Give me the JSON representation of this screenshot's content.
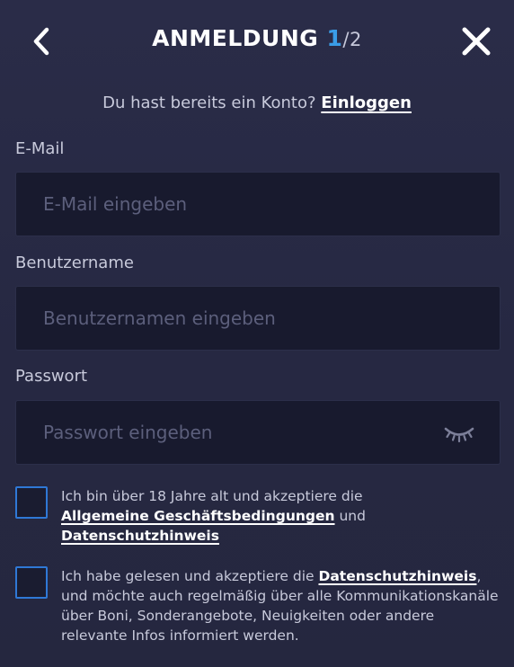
{
  "header": {
    "title": "ANMELDUNG",
    "step_current": "1",
    "step_total": "/2",
    "back_icon": "chevron-left-icon",
    "close_icon": "close-icon"
  },
  "login_prompt": {
    "text": "Du hast bereits ein Konto?",
    "link": "Einloggen"
  },
  "fields": {
    "email": {
      "label": "E-Mail",
      "value": "",
      "placeholder": "E-Mail eingeben"
    },
    "username": {
      "label": "Benutzername",
      "value": "",
      "placeholder": "Benutzernamen eingeben"
    },
    "password": {
      "label": "Passwort",
      "value": "",
      "placeholder": "Passwort eingeben",
      "toggle_icon": "eye-closed-icon"
    }
  },
  "consents": {
    "age": {
      "checked": false,
      "text_before": "Ich bin über 18 Jahre alt und akzeptiere die",
      "link_terms": "Allgemeine Geschäftsbedingungen",
      "text_and": "und",
      "link_privacy": "Datenschutzhinweis"
    },
    "marketing": {
      "checked": false,
      "text_before": "Ich habe gelesen und akzeptiere die",
      "link_privacy": "Datenschutzhinweis",
      "text_after": ", und möchte auch regelmäßig über alle Kommunikationskanäle über Boni, Sonderangebote, Neuigkeiten oder andere relevante Infos informiert werden."
    }
  },
  "colors": {
    "background": "#282a45",
    "input_background": "#181a2e",
    "accent": "#3a9de8",
    "checkbox_border": "#2f78d6",
    "placeholder": "#5c5f7c"
  }
}
